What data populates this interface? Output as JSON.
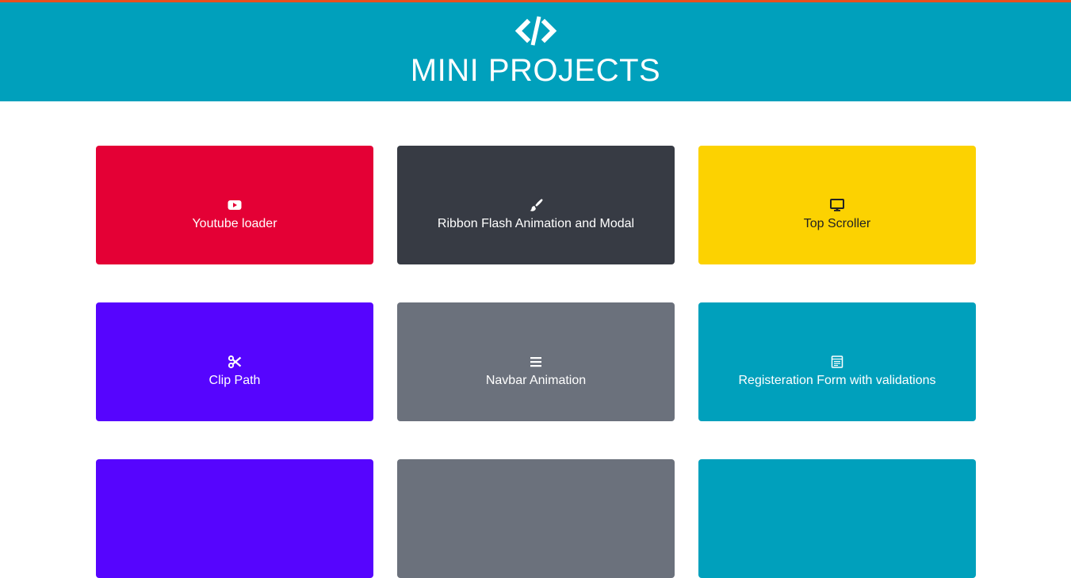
{
  "header": {
    "title": "MINI PROJECTS",
    "logo_icon": "code-icon",
    "background": "#00a0bc",
    "accent_bar": "#e8501f"
  },
  "projects": [
    {
      "label": "Youtube loader",
      "icon": "youtube-icon",
      "color": "#e40035",
      "text_color": "#ffffff"
    },
    {
      "label": "Ribbon Flash Animation and Modal",
      "icon": "paint-brush-icon",
      "color": "#373b44",
      "text_color": "#ffffff"
    },
    {
      "label": "Top Scroller",
      "icon": "desktop-icon",
      "color": "#fcd201",
      "text_color": "#222222"
    },
    {
      "label": "Clip Path",
      "icon": "scissors-icon",
      "color": "#5605fe",
      "text_color": "#ffffff"
    },
    {
      "label": "Navbar Animation",
      "icon": "bars-icon",
      "color": "#6b717c",
      "text_color": "#ffffff"
    },
    {
      "label": "Registeration Form with validations",
      "icon": "form-icon",
      "color": "#00a0bc",
      "text_color": "#ffffff"
    },
    {
      "label": "",
      "icon": "",
      "color": "#5605fe",
      "text_color": "#ffffff"
    },
    {
      "label": "",
      "icon": "",
      "color": "#6b717c",
      "text_color": "#ffffff"
    },
    {
      "label": "",
      "icon": "",
      "color": "#00a0bc",
      "text_color": "#ffffff"
    }
  ]
}
